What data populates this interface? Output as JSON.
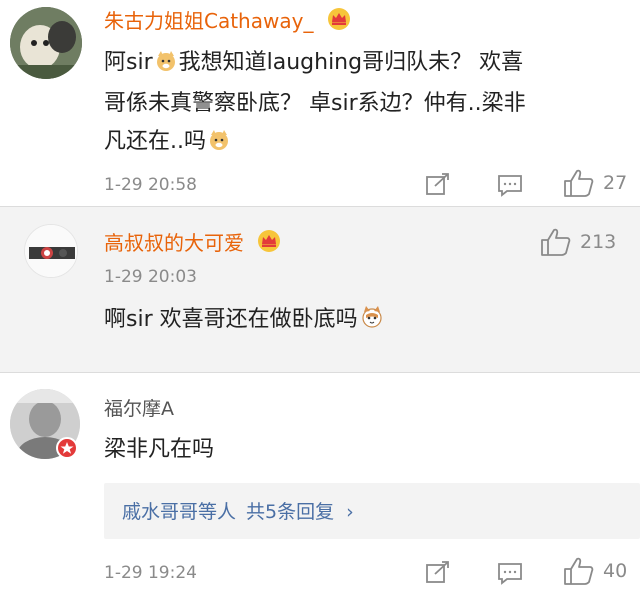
{
  "comments": [
    {
      "username": "朱古力姐姐Cathaway_",
      "text_line1": "阿sir",
      "text_line1b": "我想知道laughing哥归队未？ 欢喜",
      "text_line2": "哥係未真警察卧底？ 卓sir系边？仲有..梁非",
      "text_line3": "凡还在..吗",
      "time": "1-29 20:58",
      "likes": "27"
    },
    {
      "username": "高叔叔的大可爱",
      "time": "1-29 20:03",
      "text": "啊sir 欢喜哥还在做卧底吗",
      "likes": "213"
    },
    {
      "username": "福尔摩A",
      "text": "梁非凡在吗",
      "reply_summary": "戚水哥哥等人",
      "reply_count": "共5条回复",
      "reply_arrow": "›",
      "time": "1-29 19:24",
      "likes": "40"
    }
  ],
  "colors": {
    "username_vip": "#e8630a",
    "username_normal": "#555555",
    "link_blue": "#4a6fa5",
    "meta_gray": "#8a8a8a",
    "highlight_bg": "#f3f3f3"
  },
  "icons": [
    "crown-icon",
    "doge-emoji-icon",
    "cat-emoji-icon",
    "repost-icon",
    "comment-icon",
    "thumb-up-icon",
    "chevron-right-icon",
    "verified-badge-icon"
  ]
}
